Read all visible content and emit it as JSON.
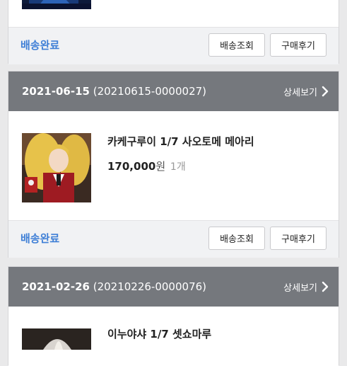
{
  "orders": [
    {
      "status": "배송완료",
      "track_label": "배송조회",
      "review_label": "구매후기"
    },
    {
      "date": "2021-06-15",
      "order_no": "(20210615-0000027)",
      "detail_label": "상세보기",
      "product_name": "카케구루이 1/7 사오토메 메아리",
      "price": "170,000",
      "currency": "원",
      "quantity": "1개",
      "status": "배송완료",
      "track_label": "배송조회",
      "review_label": "구매후기"
    },
    {
      "date": "2021-02-26",
      "order_no": "(20210226-0000076)",
      "detail_label": "상세보기",
      "product_name": "이누야샤 1/7 셋쇼마루"
    }
  ]
}
